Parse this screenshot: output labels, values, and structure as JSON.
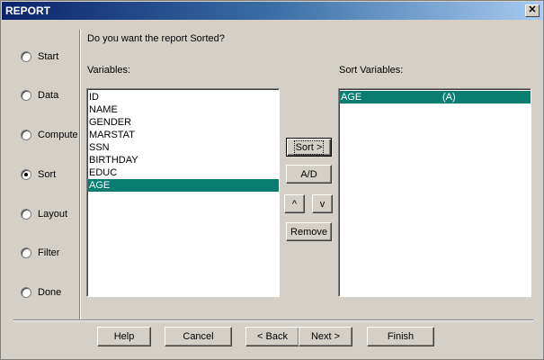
{
  "window": {
    "title": "REPORT",
    "close_glyph": "✕"
  },
  "steps": [
    {
      "label": "Start",
      "checked": false
    },
    {
      "label": "Data",
      "checked": false
    },
    {
      "label": "Compute",
      "checked": false
    },
    {
      "label": "Sort",
      "checked": true
    },
    {
      "label": "Layout",
      "checked": false
    },
    {
      "label": "Filter",
      "checked": false
    },
    {
      "label": "Done",
      "checked": false
    }
  ],
  "prompt": "Do you want the report Sorted?",
  "variables": {
    "label": "Variables:",
    "items": [
      "ID",
      "NAME",
      "GENDER",
      "MARSTAT",
      "SSN",
      "BIRTHDAY",
      "EDUC",
      "AGE"
    ],
    "selected": "AGE"
  },
  "sort_variables": {
    "label": "Sort Variables:",
    "items": [
      {
        "name": "AGE",
        "order": "(A)"
      }
    ]
  },
  "middle_buttons": {
    "sort": "Sort >",
    "ad": "A/D",
    "up": "^",
    "down": "v",
    "remove": "Remove"
  },
  "footer_buttons": {
    "help": "Help",
    "cancel": "Cancel",
    "back": "< Back",
    "next": "Next >",
    "finish": "Finish"
  }
}
